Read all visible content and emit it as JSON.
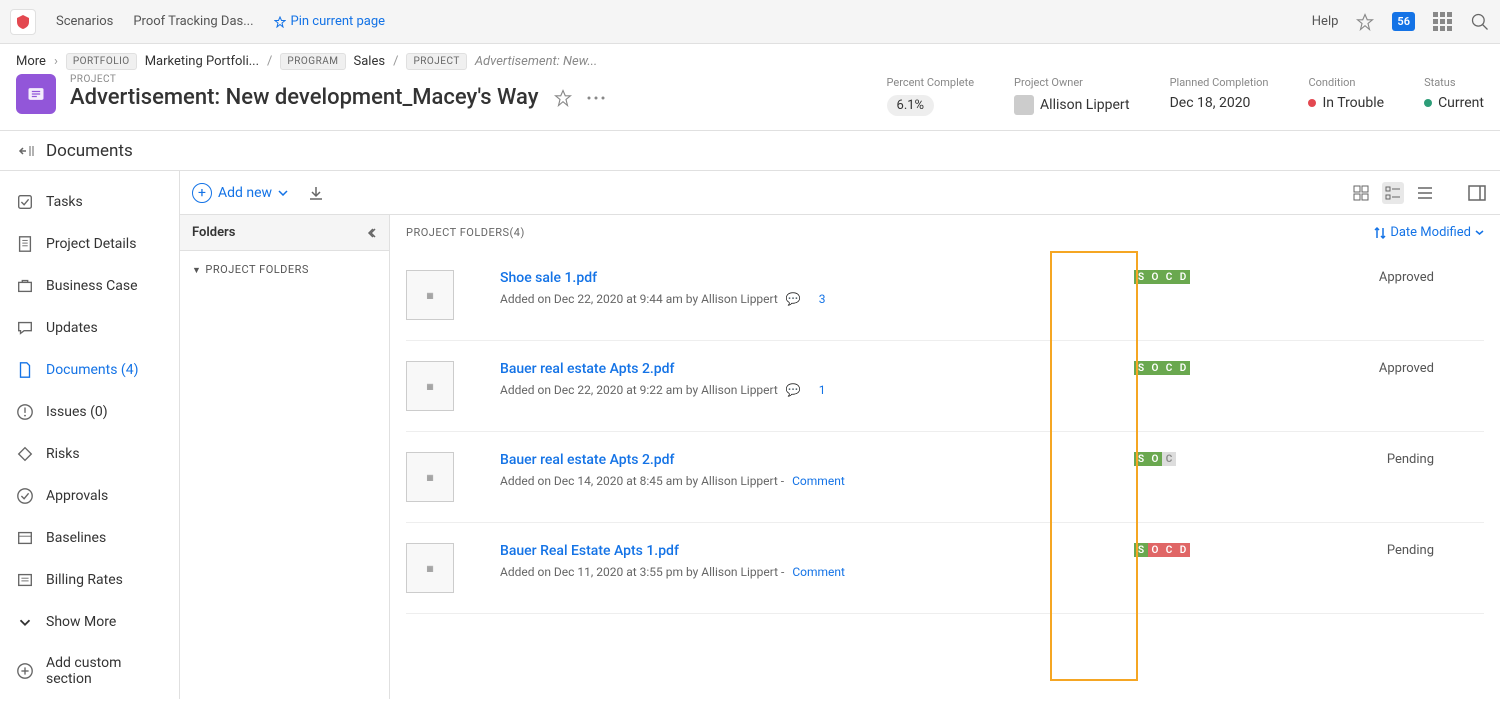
{
  "topbar": {
    "scenarios": "Scenarios",
    "proof_tracking": "Proof Tracking Das...",
    "pin": "Pin current page",
    "help": "Help",
    "notif_count": "56"
  },
  "breadcrumb": {
    "more": "More",
    "portfolio_tag": "PORTFOLIO",
    "portfolio": "Marketing Portfoli...",
    "program_tag": "PROGRAM",
    "program": "Sales",
    "project_tag": "PROJECT",
    "current": "Advertisement: New..."
  },
  "project": {
    "label": "PROJECT",
    "title": "Advertisement: New development_Macey's Way",
    "meta": {
      "percent_label": "Percent Complete",
      "percent_value": "6.1%",
      "owner_label": "Project Owner",
      "owner_value": "Allison Lippert",
      "planned_label": "Planned Completion",
      "planned_value": "Dec 18, 2020",
      "condition_label": "Condition",
      "condition_value": "In Trouble",
      "status_label": "Status",
      "status_value": "Current"
    }
  },
  "subheader": {
    "title": "Documents"
  },
  "sidebar": {
    "items": [
      {
        "label": "Tasks"
      },
      {
        "label": "Project Details"
      },
      {
        "label": "Business Case"
      },
      {
        "label": "Updates"
      },
      {
        "label": "Documents (4)"
      },
      {
        "label": "Issues (0)"
      },
      {
        "label": "Risks"
      },
      {
        "label": "Approvals"
      },
      {
        "label": "Baselines"
      },
      {
        "label": "Billing Rates"
      },
      {
        "label": "Show More"
      }
    ],
    "add_custom": "Add custom section"
  },
  "toolbar": {
    "add_new": "Add new"
  },
  "folders": {
    "header": "Folders",
    "root": "PROJECT FOLDERS"
  },
  "docs": {
    "header": "PROJECT FOLDERS(4)",
    "sort": "Date Modified",
    "items": [
      {
        "title": "Shoe sale 1.pdf",
        "meta": "Added on Dec 22, 2020 at 9:44 am by Allison Lippert",
        "comments": "3",
        "status": "Approved",
        "socd": [
          "g",
          "g",
          "g",
          "g"
        ]
      },
      {
        "title": "Bauer real estate Apts 2.pdf",
        "meta": "Added on Dec 22, 2020 at 9:22 am by Allison Lippert",
        "comments": "1",
        "status": "Approved",
        "socd": [
          "g",
          "g",
          "g",
          "g"
        ]
      },
      {
        "title": "Bauer real estate Apts 2.pdf",
        "meta": "Added on Dec 14, 2020 at 8:45 am by Allison Lippert -",
        "comment_link": "Comment",
        "status": "Pending",
        "socd": [
          "g",
          "g",
          "gray",
          null
        ]
      },
      {
        "title": "Bauer Real Estate Apts 1.pdf",
        "meta": "Added on Dec 11, 2020 at 3:55 pm by Allison Lippert -",
        "comment_link": "Comment",
        "status": "Pending",
        "socd": [
          "g",
          "r",
          "r",
          "r"
        ]
      }
    ]
  }
}
